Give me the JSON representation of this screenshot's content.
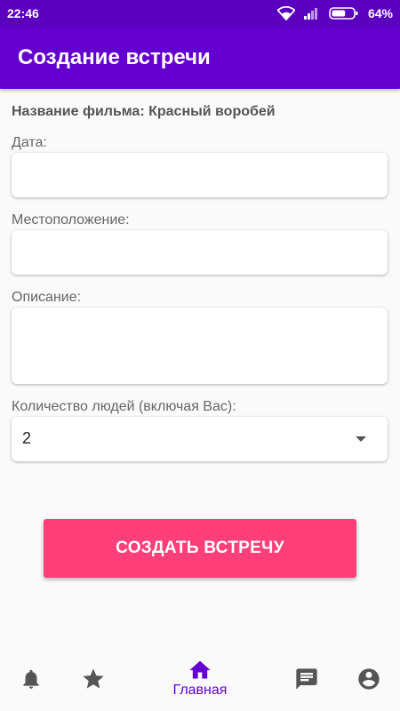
{
  "status_bar": {
    "time": "22:46",
    "battery_percent": "64%",
    "battery_level": 0.64
  },
  "app_bar": {
    "title": "Создание встречи"
  },
  "form": {
    "movie_line": "Название фильма: Красный воробей",
    "date_label": "Дата:",
    "date_value": "",
    "location_label": "Местоположение:",
    "location_value": "",
    "description_label": "Описание:",
    "description_value": "",
    "people_label": "Количество людей (включая Вас):",
    "people_value": "2"
  },
  "create_button": {
    "label": "СОЗДАТЬ ВСТРЕЧУ"
  },
  "bottom_nav": {
    "items": [
      {
        "icon": "bell-icon",
        "label": ""
      },
      {
        "icon": "star-icon",
        "label": ""
      },
      {
        "icon": "home-icon",
        "label": "Главная",
        "active": true
      },
      {
        "icon": "chat-icon",
        "label": ""
      },
      {
        "icon": "account-icon",
        "label": ""
      }
    ]
  },
  "colors": {
    "status_bar": "#5c00bf",
    "app_bar": "#6300cf",
    "accent_button": "#ff3f7a",
    "nav_active": "#6300cf",
    "nav_inactive": "#555555"
  }
}
